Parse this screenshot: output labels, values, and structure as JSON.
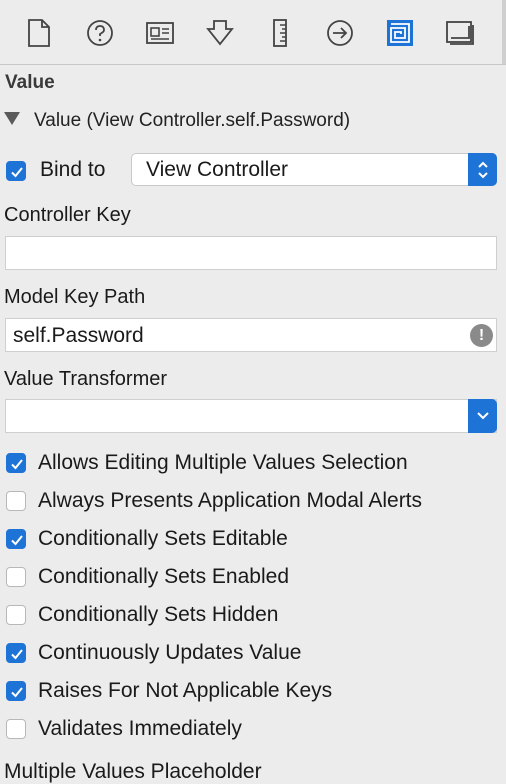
{
  "toolbar": {
    "icons": [
      {
        "name": "file-inspector-icon"
      },
      {
        "name": "quick-help-icon"
      },
      {
        "name": "identity-inspector-icon"
      },
      {
        "name": "attributes-inspector-icon"
      },
      {
        "name": "size-inspector-icon"
      },
      {
        "name": "connections-inspector-icon"
      },
      {
        "name": "bindings-inspector-icon",
        "selected": true
      },
      {
        "name": "view-effects-inspector-icon"
      }
    ]
  },
  "section": {
    "title": "Value",
    "disclosure_label": "Value (View Controller.self.Password)"
  },
  "bind": {
    "checked": true,
    "label": "Bind to",
    "selected_value": "View Controller"
  },
  "controller_key": {
    "label": "Controller Key",
    "value": ""
  },
  "model_key_path": {
    "label": "Model Key Path",
    "value": "self.Password"
  },
  "value_transformer": {
    "label": "Value Transformer",
    "value": ""
  },
  "options": [
    {
      "label": "Allows Editing Multiple Values Selection",
      "checked": true
    },
    {
      "label": "Always Presents Application Modal Alerts",
      "checked": false
    },
    {
      "label": "Conditionally Sets Editable",
      "checked": true
    },
    {
      "label": "Conditionally Sets Enabled",
      "checked": false
    },
    {
      "label": "Conditionally Sets Hidden",
      "checked": false
    },
    {
      "label": "Continuously Updates Value",
      "checked": true
    },
    {
      "label": "Raises For Not Applicable Keys",
      "checked": true
    },
    {
      "label": "Validates Immediately",
      "checked": false
    }
  ],
  "footer": {
    "partial_label": "Multiple Values Placeholder"
  },
  "colors": {
    "accent": "#1e73d6",
    "background": "#ececec"
  }
}
